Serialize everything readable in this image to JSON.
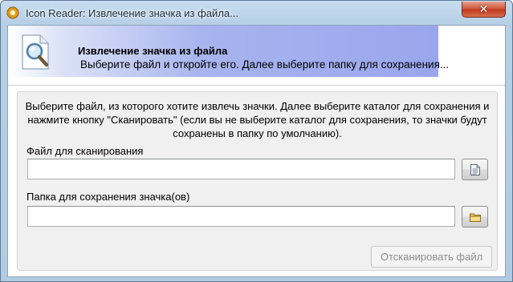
{
  "window": {
    "title": "Icon Reader: Извлечение значка из файла...",
    "close_glyph": "✕"
  },
  "header": {
    "title": "Извлечение значка из файла",
    "subtitle": "Выберите файл и откройте его. Далее выберите папку для сохранения..."
  },
  "panel": {
    "description": "Выберите файл, из которого хотите извлечь значки. Далее выберите каталог для сохранения и нажмите кнопку \"Сканировать\" (если вы не выберите каталог для сохранения, то значки будут сохранены в папку по умолчанию).",
    "file_field": {
      "label": "Файл для сканирования",
      "value": ""
    },
    "folder_field": {
      "label": "Папка для сохранения значка(ов)",
      "value": ""
    },
    "scan_button": {
      "label": "Отсканировать файл",
      "enabled": false
    }
  },
  "icons": {
    "app": "app-icon",
    "header": "magnifier-document-icon",
    "file_browse": "document-icon",
    "folder_browse": "folder-icon"
  },
  "colors": {
    "header_band": "#9aa6ec",
    "close_button": "#c2391f",
    "panel_background": "#f0f0f0"
  }
}
